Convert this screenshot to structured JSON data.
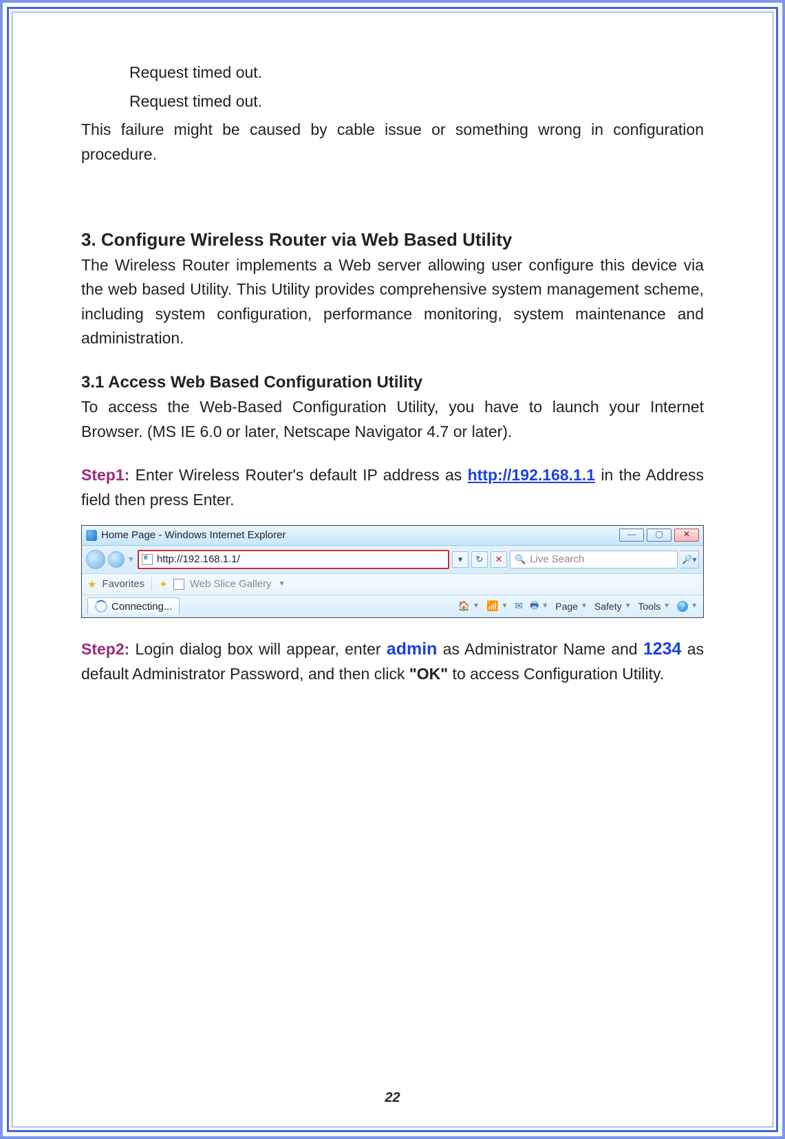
{
  "page_number": "22",
  "body": {
    "timeout_line_1": "Request timed out.",
    "timeout_line_2": "Request timed out.",
    "failure_text": "This failure might be caused by cable issue or something wrong in configuration procedure."
  },
  "section3": {
    "title": "3. Configure Wireless Router via Web Based Utility",
    "intro": "The Wireless Router implements a Web server allowing user configure this device via the web based Utility. This Utility provides comprehensive system management scheme, including system configuration, performance monitoring, system maintenance and administration."
  },
  "section31": {
    "title": "3.1 Access Web Based Configuration Utility",
    "intro": "To access the Web-Based Configuration Utility, you have to launch your Internet Browser. (MS IE 6.0 or later, Netscape Navigator 4.7 or later)."
  },
  "step1": {
    "label": "Step1:",
    "before_link": " Enter Wireless Router's default IP address as ",
    "link_text": "http://192.168.1.1",
    "link_href": "http://192.168.1.1",
    "after_link": " in the Address field then press Enter."
  },
  "step2": {
    "label": "Step2:",
    "part1": " Login dialog box will appear, enter ",
    "admin_word": "admin",
    "part2": " as Administrator Name and ",
    "pwd_word": "1234",
    "part3": " as default Administrator Password, and then click ",
    "ok_word": "\"OK\"",
    "part4": " to access Configuration Utility."
  },
  "ie": {
    "window_title": "Home Page - Windows Internet Explorer",
    "address_value": "http://192.168.1.1/",
    "search_placeholder": "Live Search",
    "favorites_label": "Favorites",
    "webslice_label": "Web Slice Gallery",
    "tab_label": "Connecting...",
    "toolbar": {
      "page": "Page",
      "safety": "Safety",
      "tools": "Tools"
    },
    "win_min": "—",
    "win_max": "▢",
    "win_close": "✕"
  }
}
